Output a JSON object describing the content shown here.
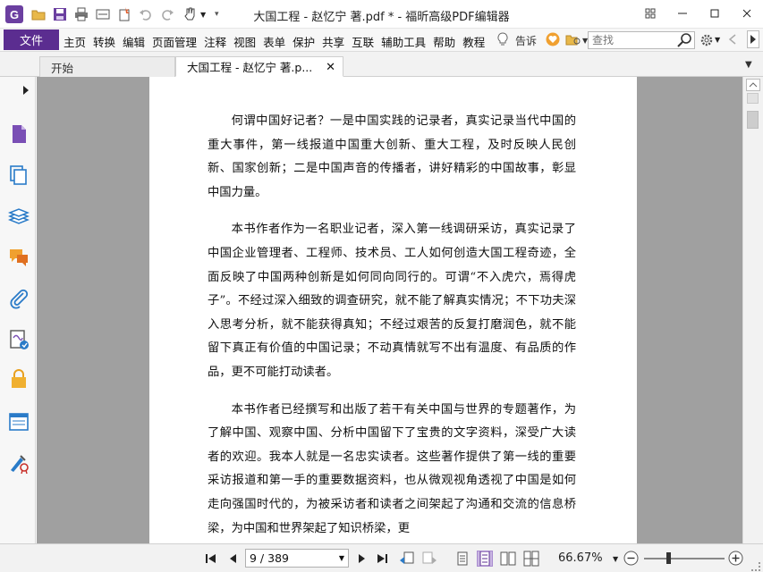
{
  "window": {
    "title": "大国工程 - 赵忆宁 著.pdf * - 福昕高级PDF编辑器",
    "app_icon_letter": "G",
    "accent_color": "#5b2d90"
  },
  "quick_access": [
    "open-folder-icon",
    "save-icon",
    "print-icon",
    "scan-icon",
    "new-icon",
    "undo-icon",
    "redo-icon",
    "hand-tool-icon"
  ],
  "menu": {
    "file_label": "文件",
    "items": [
      "主页",
      "转换",
      "编辑",
      "页面管理",
      "注释",
      "视图",
      "表单",
      "保护",
      "共享",
      "互联",
      "辅助工具",
      "帮助",
      "教程"
    ],
    "tell_me": "告诉",
    "search_placeholder": "查找"
  },
  "tabs": [
    {
      "label": "开始"
    },
    {
      "label": "大国工程 - 赵忆宁 著.p..."
    }
  ],
  "sidebar_icons": [
    "page-thumbnails-icon",
    "pages-icon",
    "layers-icon",
    "comments-icon",
    "attachments-icon",
    "signatures-icon",
    "security-icon",
    "fields-icon",
    "certify-icon"
  ],
  "document": {
    "paragraphs": [
      "何谓中国好记者？一是中国实践的记录者，真实记录当代中国的重大事件，第一线报道中国重大创新、重大工程，及时反映人民创新、国家创新；二是中国声音的传播者，讲好精彩的中国故事，彰显中国力量。",
      "本书作者作为一名职业记者，深入第一线调研采访，真实记录了中国企业管理者、工程师、技术员、工人如何创造大国工程奇迹，全面反映了中国两种创新是如何同向同行的。可谓“不入虎穴，焉得虎子”。不经过深入细致的调查研究，就不能了解真实情况；不下功夫深入思考分析，就不能获得真知；不经过艰苦的反复打磨润色，就不能留下真正有价值的中国记录；不动真情就写不出有温度、有品质的作品，更不可能打动读者。",
      "本书作者已经撰写和出版了若干有关中国与世界的专题著作，为了解中国、观察中国、分析中国留下了宝贵的文字资料，深受广大读者的欢迎。我本人就是一名忠实读者。这些著作提供了第一线的重要采访报道和第一手的重要数据资料，也从微观视角透视了中国是如何走向强国时代的，为被采访者和读者之间架起了沟通和交流的信息桥梁，为中国和世界架起了知识桥梁，更"
    ]
  },
  "status": {
    "page_display": "9 / 389",
    "zoom": "66.67%",
    "zoom_level_fraction": 0.3
  }
}
